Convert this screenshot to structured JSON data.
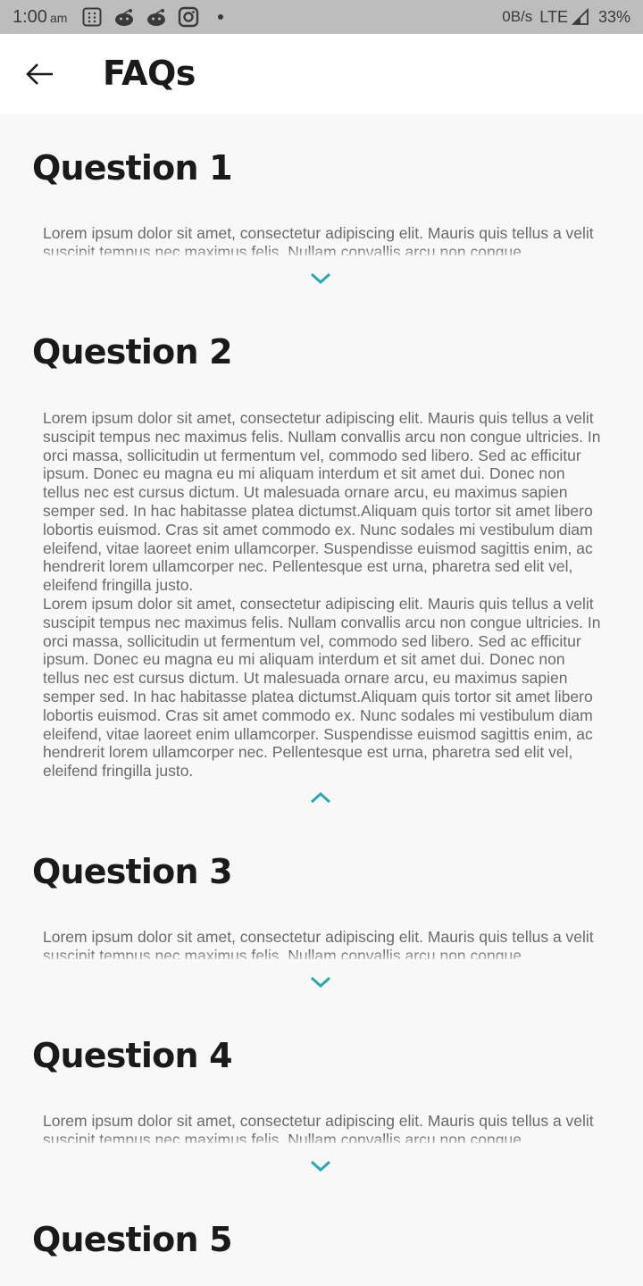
{
  "status_bar": {
    "time": "1:00",
    "ampm": "am",
    "net_speed": "0B/s",
    "network": "LTE",
    "battery": "33%",
    "icons": [
      "calculator-icon",
      "reddit-icon",
      "reddit-icon",
      "instagram-icon",
      "dot-icon",
      "signal-icon"
    ]
  },
  "app_bar": {
    "back_icon": "arrow-left-icon",
    "title": "FAQs"
  },
  "colors": {
    "accent": "#2aa7b3",
    "background": "#f8f8f8",
    "app_bar": "#ffffff",
    "status_bar": "#bdbdbd"
  },
  "faqs": [
    {
      "question": "Question 1",
      "answer": "Lorem ipsum dolor sit amet, consectetur adipiscing elit. Mauris quis tellus a velit suscipit tempus nec maximus felis. Nullam convallis arcu non congue",
      "expanded": false,
      "toggle_icon": "chevron-down-icon"
    },
    {
      "question": "Question 2",
      "answer": "Lorem ipsum dolor sit amet, consectetur adipiscing elit. Mauris quis tellus a velit suscipit tempus nec maximus felis. Nullam convallis arcu non congue ultricies. In orci massa, sollicitudin ut fermentum vel, commodo sed libero. Sed ac efficitur ipsum. Donec eu magna eu mi aliquam interdum et sit amet dui. Donec non tellus nec est cursus dictum. Ut malesuada ornare arcu, eu maximus sapien semper sed. In hac habitasse platea dictumst.Aliquam quis tortor sit amet libero lobortis euismod. Cras sit amet commodo ex. Nunc sodales mi vestibulum diam eleifend, vitae laoreet enim ullamcorper. Suspendisse euismod sagittis enim, ac hendrerit lorem ullamcorper nec. Pellentesque est urna, pharetra sed elit vel, eleifend fringilla justo.\nLorem ipsum dolor sit amet, consectetur adipiscing elit. Mauris quis tellus a velit suscipit tempus nec maximus felis. Nullam convallis arcu non congue ultricies. In orci massa, sollicitudin ut fermentum vel, commodo sed libero. Sed ac efficitur ipsum. Donec eu magna eu mi aliquam interdum et sit amet dui. Donec non tellus nec est cursus dictum. Ut malesuada ornare arcu, eu maximus sapien semper sed. In hac habitasse platea dictumst.Aliquam quis tortor sit amet libero lobortis euismod. Cras sit amet commodo ex. Nunc sodales mi vestibulum diam eleifend, vitae laoreet enim ullamcorper. Suspendisse euismod sagittis enim, ac hendrerit lorem ullamcorper nec. Pellentesque est urna, pharetra sed elit vel, eleifend fringilla justo.",
      "expanded": true,
      "toggle_icon": "chevron-up-icon"
    },
    {
      "question": "Question 3",
      "answer": "Lorem ipsum dolor sit amet, consectetur adipiscing elit. Mauris quis tellus a velit suscipit tempus nec maximus felis. Nullam convallis arcu non congue",
      "expanded": false,
      "toggle_icon": "chevron-down-icon"
    },
    {
      "question": "Question 4",
      "answer": "Lorem ipsum dolor sit amet, consectetur adipiscing elit. Mauris quis tellus a velit suscipit tempus nec maximus felis. Nullam convallis arcu non congue",
      "expanded": false,
      "toggle_icon": "chevron-down-icon"
    },
    {
      "question": "Question 5"
    }
  ]
}
